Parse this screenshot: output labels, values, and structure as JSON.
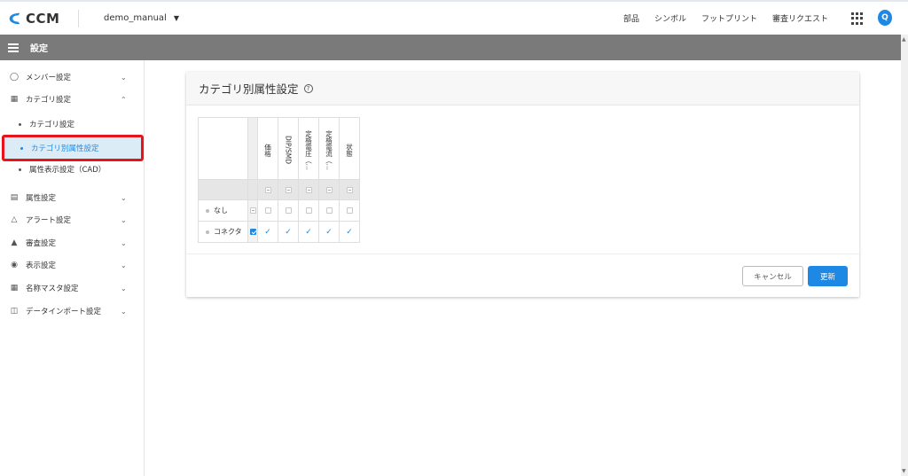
{
  "header": {
    "logo_text": "CCM",
    "project_name": "demo_manual",
    "nav": [
      "部品",
      "シンボル",
      "フットプリント",
      "審査リクエスト"
    ],
    "user_initial": "Q",
    "brand_color": "#1e88e5"
  },
  "subheader": {
    "title": "設定"
  },
  "sidebar": {
    "items": [
      {
        "icon": "person-icon",
        "label": "メンバー設定",
        "expanded": false
      },
      {
        "icon": "grid-list-icon",
        "label": "カテゴリ設定",
        "expanded": true
      },
      {
        "icon": "document-icon",
        "label": "属性設定",
        "expanded": false
      },
      {
        "icon": "bell-icon",
        "label": "アラート設定",
        "expanded": false
      },
      {
        "icon": "stamp-icon",
        "label": "審査設定",
        "expanded": false
      },
      {
        "icon": "eye-icon",
        "label": "表示設定",
        "expanded": false
      },
      {
        "icon": "table-icon",
        "label": "名称マスタ設定",
        "expanded": false
      },
      {
        "icon": "database-icon",
        "label": "データインポート設定",
        "expanded": false
      }
    ],
    "subitems": [
      {
        "label": "カテゴリ設定",
        "active": false
      },
      {
        "label": "カテゴリ別属性設定",
        "active": true
      },
      {
        "label": "属性表示設定（CAD）",
        "active": false
      }
    ]
  },
  "card": {
    "title": "カテゴリ別属性設定",
    "columns": [
      "価格",
      "DIP/SMD",
      "定格電圧（…",
      "定格電流（…",
      "状態"
    ],
    "rows": [
      {
        "label": "なし",
        "row_checked": false,
        "cells": [
          false,
          false,
          false,
          false,
          false
        ]
      },
      {
        "label": "コネクタ",
        "row_checked": true,
        "cells": [
          true,
          true,
          true,
          true,
          true
        ]
      }
    ],
    "cancel_label": "キャンセル",
    "update_label": "更新"
  }
}
